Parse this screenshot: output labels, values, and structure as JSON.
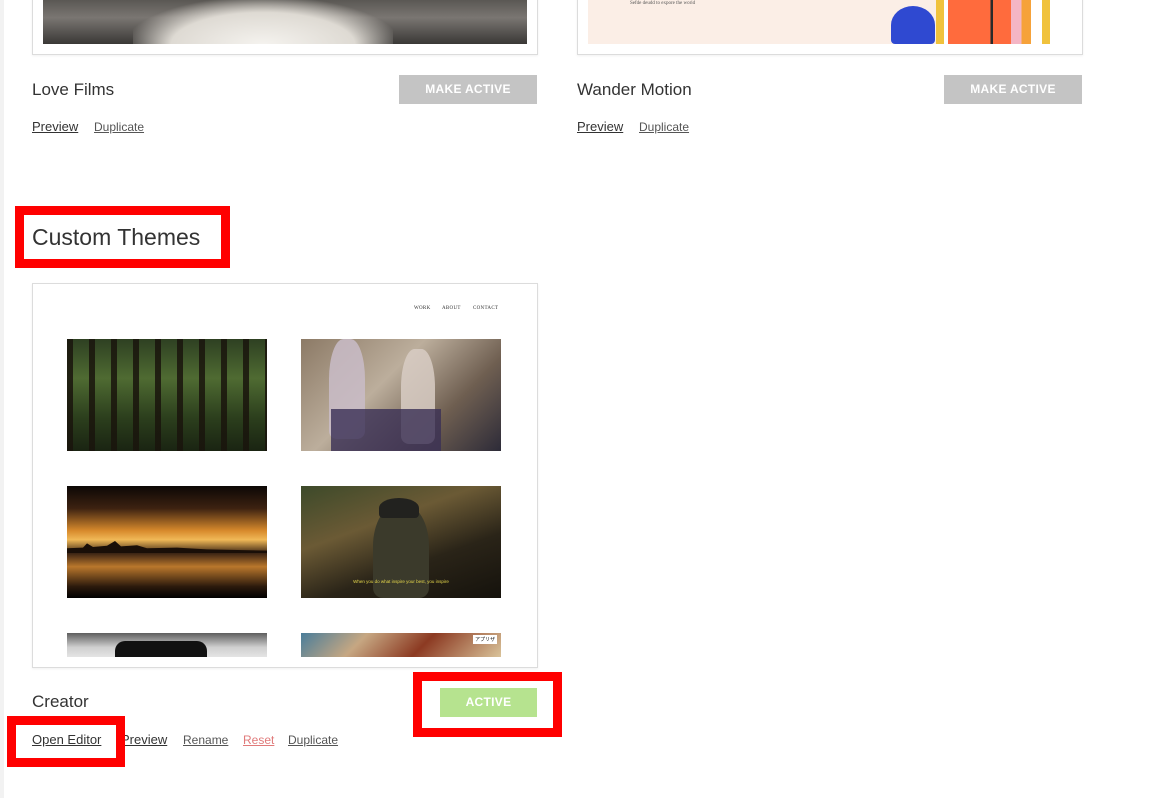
{
  "top_themes": [
    {
      "name": "Love Films",
      "button_label": "MAKE ACTIVE",
      "links": {
        "preview": "Preview",
        "duplicate": "Duplicate"
      }
    },
    {
      "name": "Wander Motion",
      "button_label": "MAKE ACTIVE",
      "links": {
        "preview": "Preview",
        "duplicate": "Duplicate"
      },
      "thumb_text": "Sefde deudd to expore the worid"
    }
  ],
  "custom_section": {
    "title": "Custom Themes"
  },
  "custom_theme": {
    "name": "Creator",
    "button_label": "ACTIVE",
    "nav": [
      "WORK",
      "ABOUT",
      "CONTACT"
    ],
    "subtitle_en": "When you do what inspire your best, you inspire",
    "badge": "アプリザ",
    "links": {
      "open_editor": "Open Editor",
      "preview": "Preview",
      "rename": "Rename",
      "reset": "Reset",
      "duplicate": "Duplicate"
    }
  },
  "colors": {
    "highlight": "#ff0000",
    "active_green": "#b6e38f",
    "inactive_gray": "#c4c4c4",
    "reset_red": "#e07a7a"
  }
}
